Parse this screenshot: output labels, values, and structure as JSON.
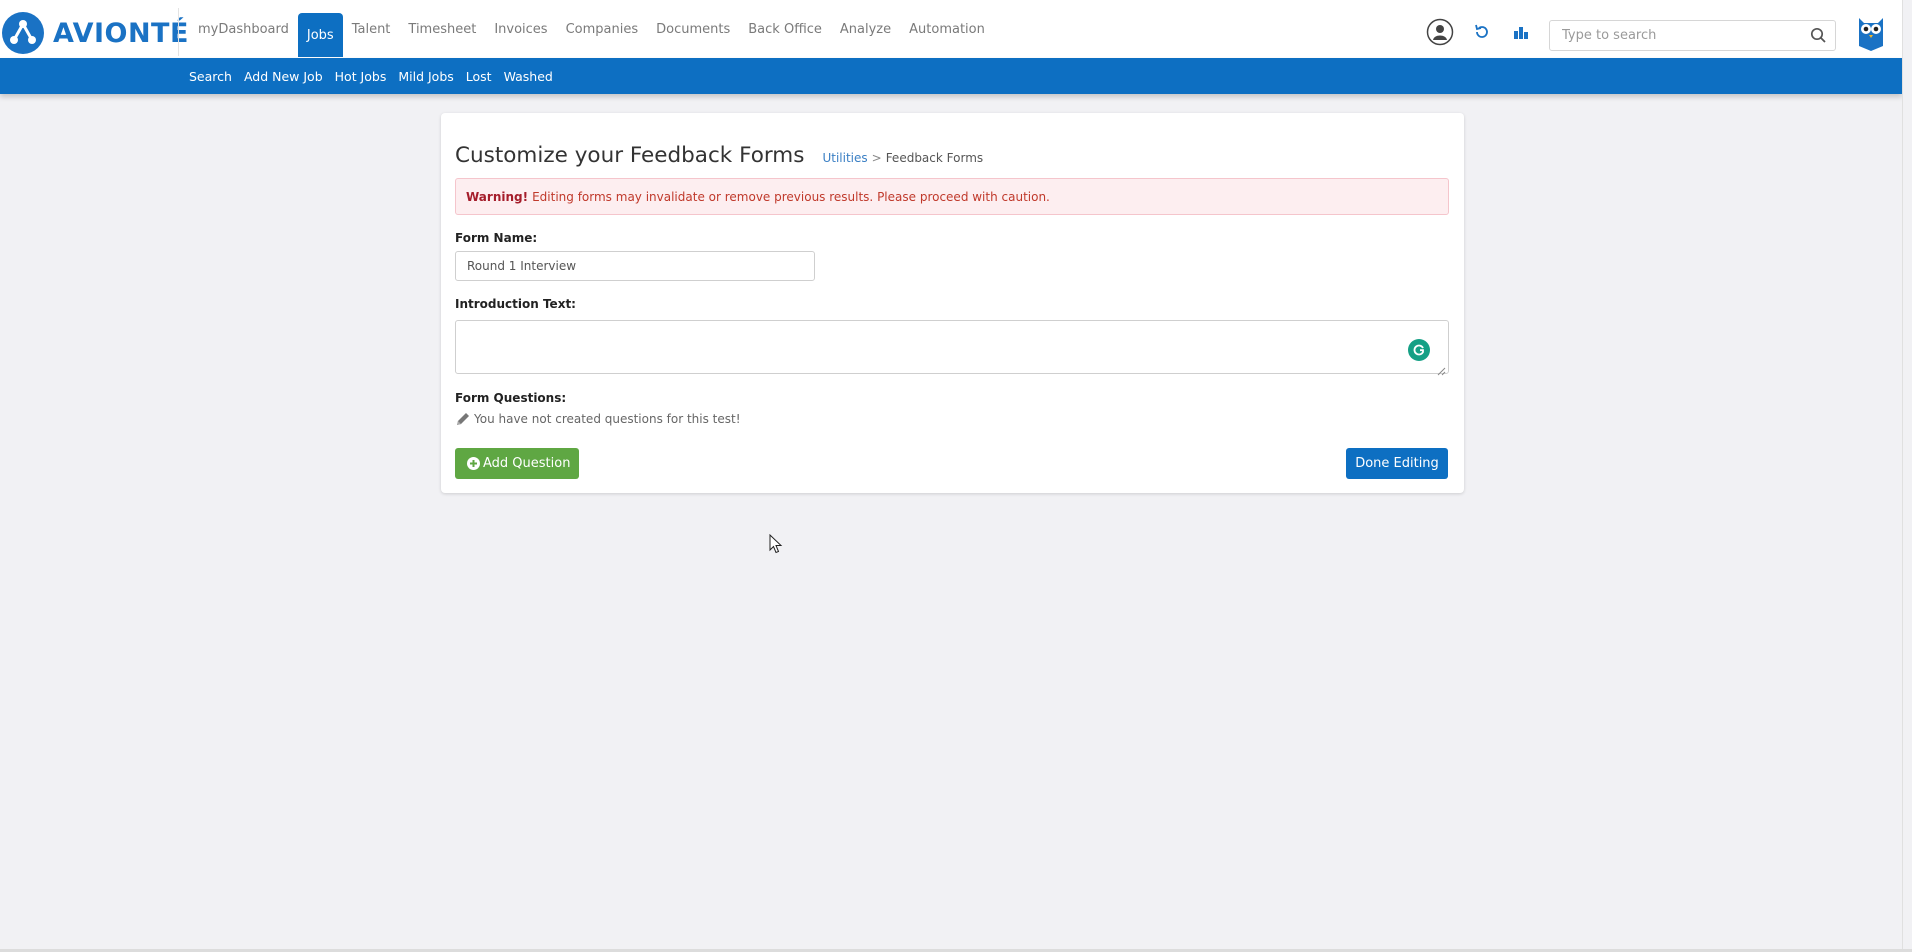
{
  "brand": {
    "name": "AVIONTÉ",
    "accent": "#0d6fc2"
  },
  "main_nav": [
    {
      "label": "myDashboard",
      "active": false
    },
    {
      "label": "Jobs",
      "active": true
    },
    {
      "label": "Talent",
      "active": false
    },
    {
      "label": "Timesheet",
      "active": false
    },
    {
      "label": "Invoices",
      "active": false
    },
    {
      "label": "Companies",
      "active": false
    },
    {
      "label": "Documents",
      "active": false
    },
    {
      "label": "Back Office",
      "active": false
    },
    {
      "label": "Analyze",
      "active": false
    },
    {
      "label": "Automation",
      "active": false
    }
  ],
  "toolbar": {
    "icons": [
      "user-icon",
      "refresh-icon",
      "bar-chart-icon"
    ],
    "search_placeholder": "Type to search"
  },
  "sub_nav": [
    "Search",
    "Add New Job",
    "Hot Jobs",
    "Mild Jobs",
    "Lost",
    "Washed"
  ],
  "page": {
    "title": "Customize your Feedback Forms",
    "breadcrumb_link": "Utilities",
    "breadcrumb_sep": ">",
    "breadcrumb_current": "Feedback Forms"
  },
  "alert": {
    "strong": "Warning!",
    "message": "Editing forms may invalidate or remove previous results. Please proceed with caution."
  },
  "form": {
    "name_label": "Form Name:",
    "name_value": "Round 1 Interview",
    "intro_label": "Introduction Text:",
    "intro_value": "",
    "questions_label": "Form Questions:",
    "questions_empty": "You have not created questions for this test!"
  },
  "buttons": {
    "add_question": "Add Question",
    "done_editing": "Done Editing"
  }
}
